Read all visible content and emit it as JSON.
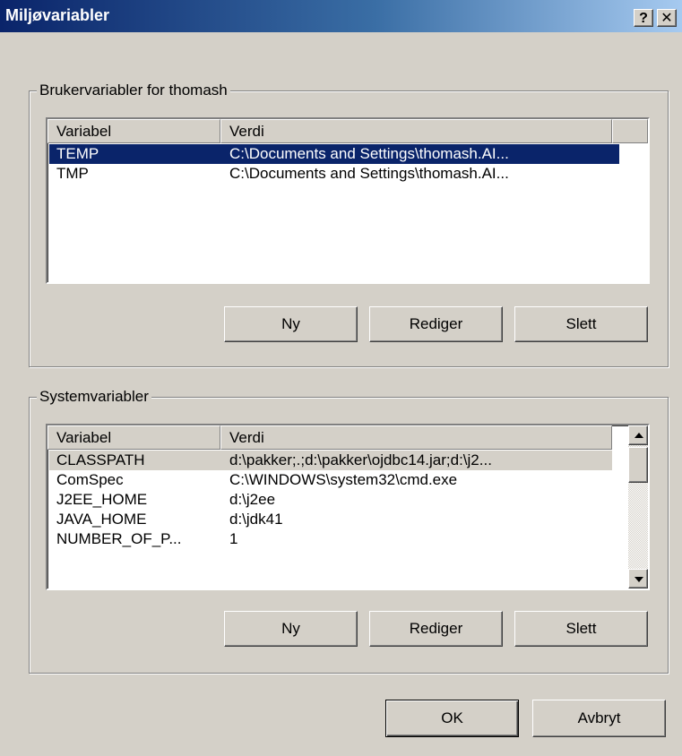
{
  "window": {
    "title": "Miljøvariabler",
    "help_glyph": "?",
    "close_glyph": "✕"
  },
  "user_group": {
    "label": "Brukervariabler for thomash",
    "columns": [
      "Variabel",
      "Verdi"
    ],
    "rows": [
      {
        "variable": "TEMP",
        "value": "C:\\Documents and Settings\\thomash.AI...",
        "selected": true
      },
      {
        "variable": "TMP",
        "value": "C:\\Documents and Settings\\thomash.AI...",
        "selected": false
      }
    ],
    "buttons": {
      "new": "Ny",
      "edit": "Rediger",
      "delete": "Slett"
    }
  },
  "system_group": {
    "label": "Systemvariabler",
    "columns": [
      "Variabel",
      "Verdi"
    ],
    "rows": [
      {
        "variable": "CLASSPATH",
        "value": "d:\\pakker;.;d:\\pakker\\ojdbc14.jar;d:\\j2...",
        "selected": true
      },
      {
        "variable": "ComSpec",
        "value": "C:\\WINDOWS\\system32\\cmd.exe",
        "selected": false
      },
      {
        "variable": "J2EE_HOME",
        "value": "d:\\j2ee",
        "selected": false
      },
      {
        "variable": "JAVA_HOME",
        "value": "d:\\jdk41",
        "selected": false
      },
      {
        "variable": "NUMBER_OF_P...",
        "value": "1",
        "selected": false
      }
    ],
    "buttons": {
      "new": "Ny",
      "edit": "Rediger",
      "delete": "Slett"
    }
  },
  "footer": {
    "ok": "OK",
    "cancel": "Avbryt"
  },
  "colors": {
    "selection": "#0a246a",
    "face": "#d4d0c8",
    "title_start": "#0a246a",
    "title_end": "#a6caf0"
  }
}
